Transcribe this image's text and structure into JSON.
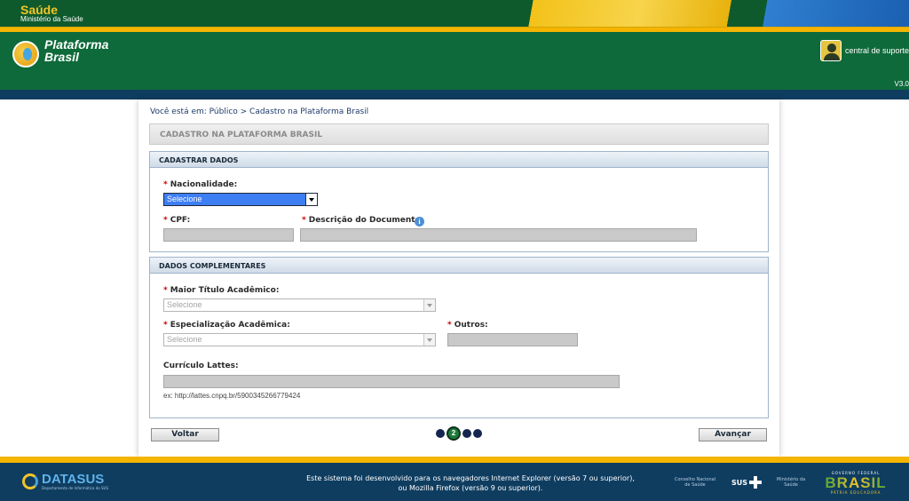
{
  "gov_bar": {
    "title": "Saúde",
    "subtitle": "Ministério da Saúde"
  },
  "header": {
    "logo_text": "Plataforma Brasil",
    "support_label": "central de suporte",
    "version": "V3.0"
  },
  "breadcrumb": "Você está em: Público > Cadastro na Plataforma Brasil",
  "page_title": "CADASTRO NA PLATAFORMA BRASIL",
  "cadastrar_dados": {
    "title": "CADASTRAR DADOS",
    "nacionalidade": {
      "label": "Nacionalidade:",
      "value": "Selecione"
    },
    "cpf": {
      "label": "CPF:",
      "value": ""
    },
    "descricao": {
      "label": "Descrição do Documento:",
      "value": ""
    },
    "info_glyph": "i"
  },
  "dados_complementares": {
    "title": "DADOS COMPLEMENTARES",
    "maior_titulo": {
      "label": "Maior Título Acadêmico:",
      "value": "Selecione"
    },
    "especializacao": {
      "label": "Especialização Acadêmica:",
      "value": "Selecione"
    },
    "outros": {
      "label": "Outros:",
      "value": ""
    },
    "curriculo": {
      "label": "Currículo Lattes:",
      "value": "",
      "hint": "ex: http://lattes.cnpq.br/5900345266779424"
    }
  },
  "required_mark": "*",
  "navigation": {
    "back_label": "Voltar",
    "next_label": "Avançar",
    "current_step": "2",
    "total_steps": 4
  },
  "footer": {
    "datasus_title": "DATASUS",
    "datasus_sub": "Departamento de Informática do SUS",
    "message_line1": "Este sistema foi desenvolvido para os navegadores Internet Explorer (versão 7 ou superior),",
    "message_line2": "ou Mozilla Firefox (versão 9 ou superior).",
    "logo_conselho": "Conselho Nacional de Saúde",
    "logo_sus": "SUS",
    "logo_ministerio": "Ministério da Saúde",
    "gov_federal": "GOVERNO FEDERAL",
    "brasil": "BRASIL",
    "patria": "PÁTRIA EDUCADORA"
  },
  "colors": {
    "header_green": "#0e6a3a",
    "gold": "#f4b400",
    "navy": "#0f3d60",
    "panel_border": "#9fb4cc",
    "required_red": "#cc0000"
  }
}
